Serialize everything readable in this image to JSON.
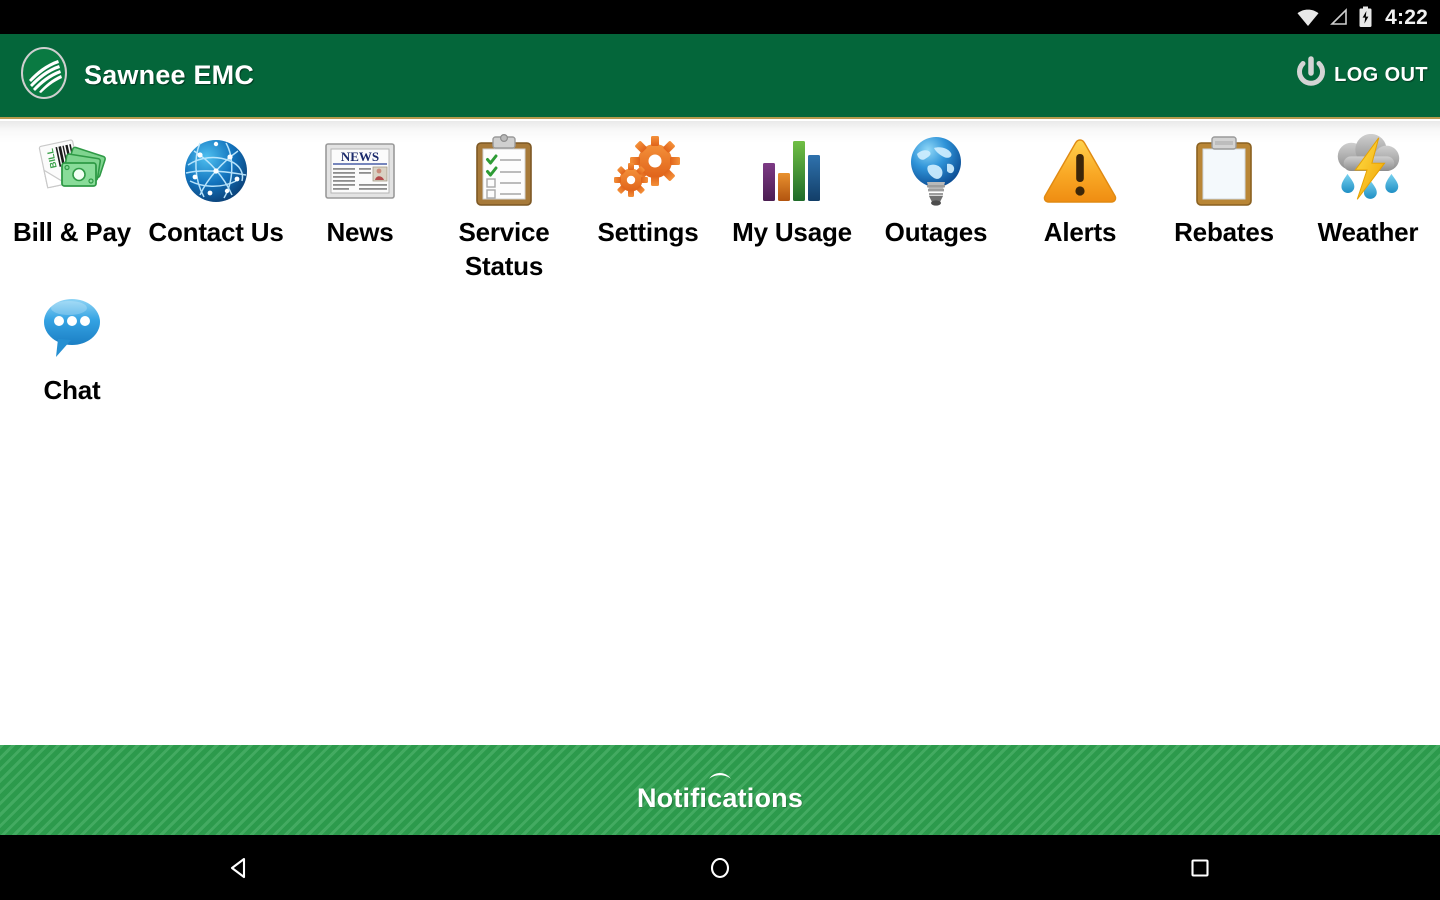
{
  "status_bar": {
    "time": "4:22",
    "icons": [
      "wifi-icon",
      "cell-signal-icon",
      "battery-charging-icon"
    ]
  },
  "app_bar": {
    "logo_icon": "sawnee-emc-logo-icon",
    "title": "Sawnee EMC",
    "logout_label": "LOG OUT",
    "logout_icon": "power-icon",
    "background_color": "#04663a",
    "accent_underline_color": "#b79a4e"
  },
  "menu": {
    "items": [
      {
        "label": "Bill & Pay",
        "icon": "bill-and-cash-icon"
      },
      {
        "label": "Contact Us",
        "icon": "network-globe-icon"
      },
      {
        "label": "News",
        "icon": "newspaper-icon"
      },
      {
        "label": "Service Status",
        "icon": "clipboard-checklist-icon"
      },
      {
        "label": "Settings",
        "icon": "gears-icon"
      },
      {
        "label": "My Usage",
        "icon": "bar-chart-icon"
      },
      {
        "label": "Outages",
        "icon": "globe-lightbulb-icon"
      },
      {
        "label": "Alerts",
        "icon": "warning-triangle-icon"
      },
      {
        "label": "Rebates",
        "icon": "clipboard-blank-icon"
      },
      {
        "label": "Weather",
        "icon": "storm-cloud-icon"
      },
      {
        "label": "Chat",
        "icon": "speech-bubble-icon"
      }
    ]
  },
  "notifications_drawer": {
    "label": "Notifications",
    "handle_icon": "chevron-up-icon",
    "background_color": "#2ea14f"
  },
  "nav_bar": {
    "back_label": "Back",
    "home_label": "Home",
    "recents_label": "Recent apps"
  }
}
